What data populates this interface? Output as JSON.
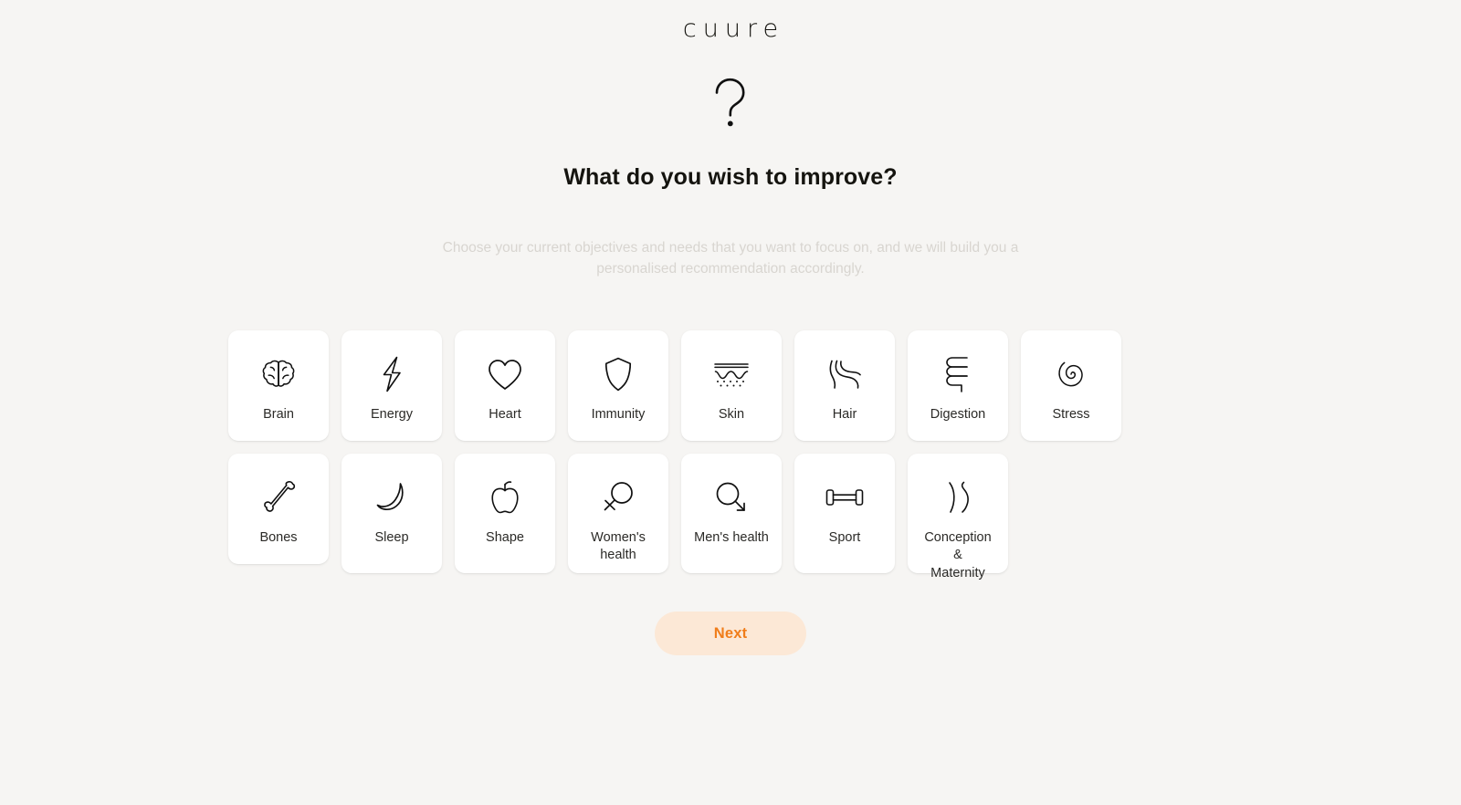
{
  "brand": {
    "logo_text": "cuure"
  },
  "hero": {
    "icon": "question-mark-icon",
    "headline": "What do you wish to improve?",
    "subline": "Choose your current objectives and needs that you want to focus on, and we will build you a personalised recommendation accordingly."
  },
  "options": {
    "row1": [
      {
        "id": "brain",
        "label": "Brain",
        "icon": "brain-icon"
      },
      {
        "id": "energy",
        "label": "Energy",
        "icon": "lightning-bolt-icon"
      },
      {
        "id": "heart",
        "label": "Heart",
        "icon": "heart-icon"
      },
      {
        "id": "immunity",
        "label": "Immunity",
        "icon": "shield-icon"
      },
      {
        "id": "skin",
        "label": "Skin",
        "icon": "skin-layer-icon"
      },
      {
        "id": "hair",
        "label": "Hair",
        "icon": "hair-strands-icon"
      },
      {
        "id": "digestion",
        "label": "Digestion",
        "icon": "intestine-icon"
      },
      {
        "id": "stress",
        "label": "Stress",
        "icon": "spiral-icon"
      },
      {
        "id": "bones",
        "label": "Bones",
        "icon": "bone-icon"
      }
    ],
    "row2": [
      {
        "id": "sleep",
        "label": "Sleep",
        "icon": "crescent-moon-icon"
      },
      {
        "id": "shape",
        "label": "Shape",
        "icon": "apple-icon"
      },
      {
        "id": "womens",
        "label": "Women's\nhealth",
        "icon": "venus-symbol-icon"
      },
      {
        "id": "mens",
        "label": "Men's health",
        "icon": "mars-symbol-icon"
      },
      {
        "id": "sport",
        "label": "Sport",
        "icon": "dumbbell-icon"
      },
      {
        "id": "conception",
        "label": "Conception &\nMaternity",
        "icon": "crescents-icon"
      }
    ]
  },
  "footer": {
    "next_label": "Next"
  },
  "colors": {
    "page_background": "#f6f5f3",
    "card_background": "#ffffff",
    "text_primary": "#15140f",
    "text_muted": "#d8d5d0",
    "accent_orange": "#f07d1a",
    "accent_orange_soft": "#fce8d6"
  }
}
